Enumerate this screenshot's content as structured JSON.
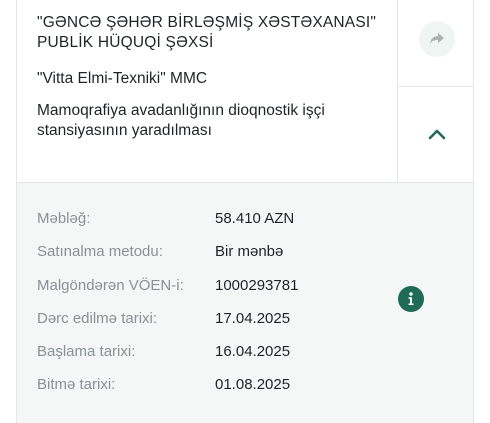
{
  "tender": {
    "organization": "\"GƏNCƏ ŞƏHƏR BİRLƏŞMİŞ XƏSTƏXANASI\" PUBLİK HÜQUQİ ŞƏXSİ",
    "supplier": "\"Vitta Elmi-Texniki\" MMC",
    "subject": "Mamoqrafiya avadanlığının dioqnostik işçi stansiyasının yaradılması"
  },
  "actions": {
    "share_icon": "share-arrow-icon",
    "collapse_icon": "chevron-up-icon",
    "info_icon": "info-icon"
  },
  "details": [
    {
      "label": "Məbləğ:",
      "value": "58.410 AZN"
    },
    {
      "label": "Satınalma metodu:",
      "value": "Bir mənbə"
    },
    {
      "label": "Malgöndərən VÖEN-i:",
      "value": "1000293781"
    },
    {
      "label": "Dərc edilmə tarixi:",
      "value": "17.04.2025"
    },
    {
      "label": "Başlama tarixi:",
      "value": "16.04.2025"
    },
    {
      "label": "Bitmə tarixi:",
      "value": "01.08.2025"
    }
  ],
  "colors": {
    "accent": "#1f6b57",
    "label_gray": "#8a9096",
    "panel_bg": "#f5f7f7"
  }
}
